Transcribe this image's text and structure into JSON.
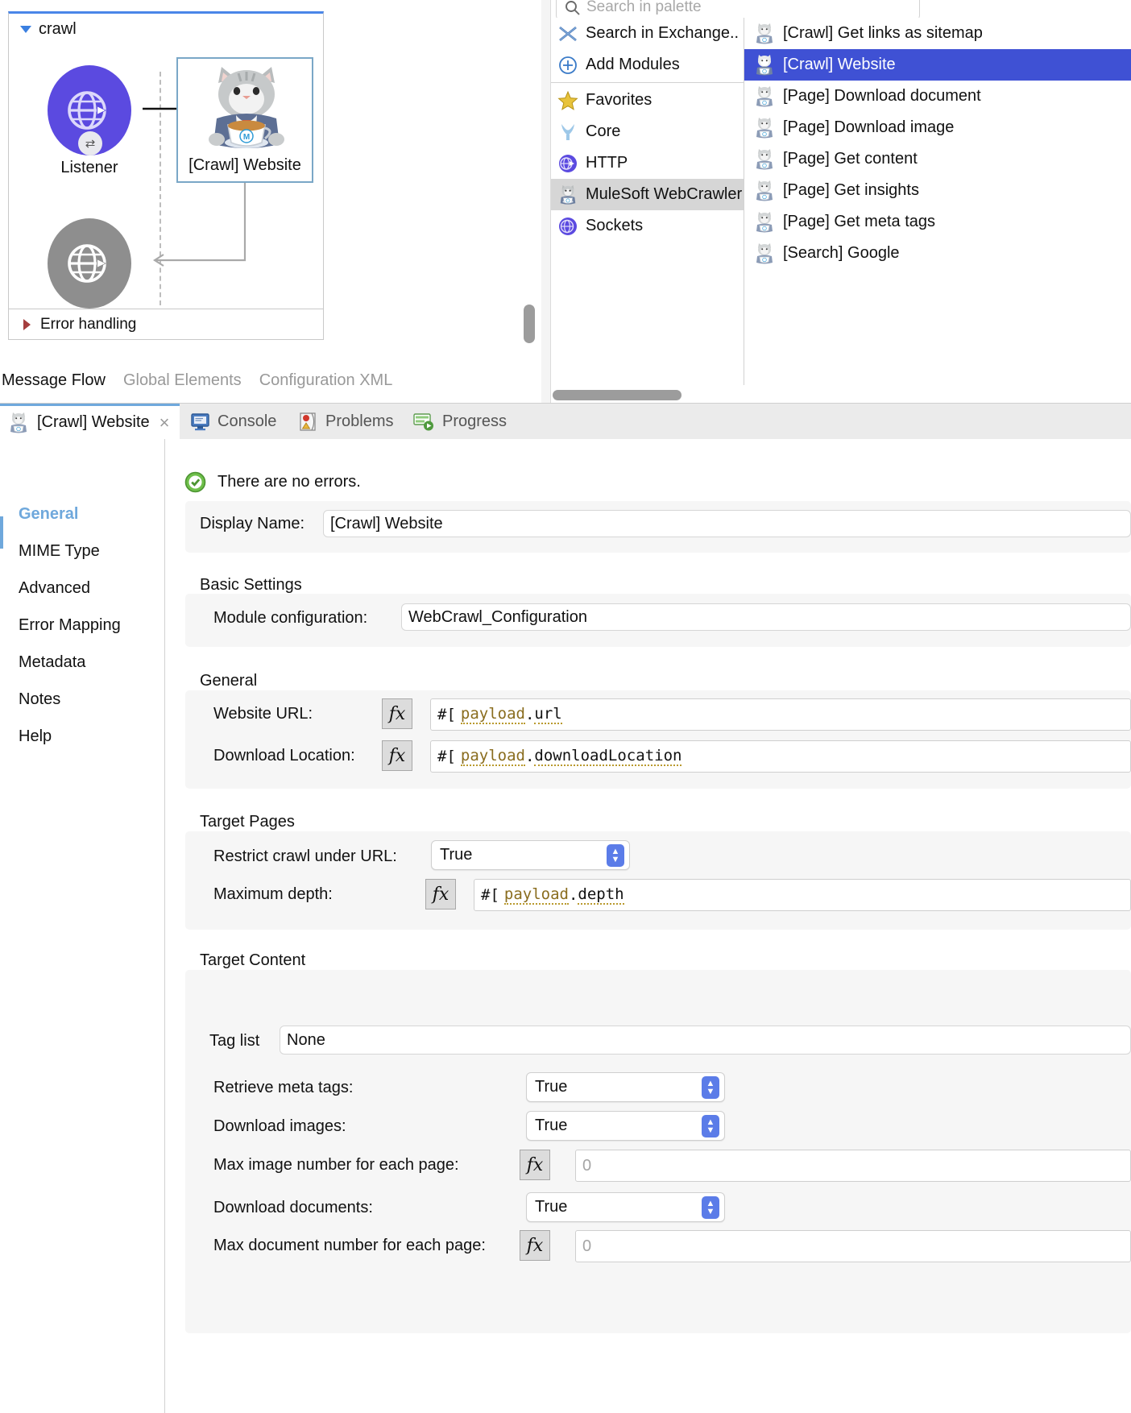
{
  "canvas": {
    "flow_name": "crawl",
    "nodes": [
      {
        "label": "Listener",
        "icon": "globe-arrow-icon"
      },
      {
        "label": "[Crawl] Website",
        "icon": "mulesoft-cat-icon"
      },
      {
        "label": "",
        "icon": "globe-arrow-icon"
      }
    ],
    "error_handling_label": "Error handling",
    "editor_tabs": [
      {
        "label": "Message Flow",
        "active": true
      },
      {
        "label": "Global Elements",
        "active": false
      },
      {
        "label": "Configuration XML",
        "active": false
      }
    ]
  },
  "palette": {
    "search_placeholder": "Search in palette",
    "categories": [
      {
        "label": "Search in Exchange..",
        "icon": "exchange-icon",
        "selected": false
      },
      {
        "label": "Add Modules",
        "icon": "plus-circle-icon",
        "selected": false
      },
      {
        "label": "Favorites",
        "icon": "star-icon",
        "selected": false
      },
      {
        "label": "Core",
        "icon": "mule-icon",
        "selected": false
      },
      {
        "label": "HTTP",
        "icon": "globe-icon",
        "selected": false
      },
      {
        "label": "MuleSoft WebCrawler",
        "icon": "cat-icon",
        "selected": true
      },
      {
        "label": "Sockets",
        "icon": "globe-icon",
        "selected": false
      }
    ],
    "operations": [
      {
        "label": "[Crawl] Get links as sitemap",
        "highlighted": false
      },
      {
        "label": "[Crawl] Website",
        "highlighted": true
      },
      {
        "label": "[Page] Download document",
        "highlighted": false
      },
      {
        "label": "[Page] Download image",
        "highlighted": false
      },
      {
        "label": "[Page] Get content",
        "highlighted": false
      },
      {
        "label": "[Page] Get insights",
        "highlighted": false
      },
      {
        "label": "[Page] Get meta tags",
        "highlighted": false
      },
      {
        "label": "[Search] Google",
        "highlighted": false
      }
    ],
    "highlight_color": "#3f51d4"
  },
  "view_tabs": {
    "active": {
      "label": "[Crawl] Website",
      "icon": "cat-icon",
      "close": "×"
    },
    "others": [
      {
        "label": "Console",
        "icon": "console-icon"
      },
      {
        "label": "Problems",
        "icon": "problems-icon"
      },
      {
        "label": "Progress",
        "icon": "progress-icon"
      }
    ]
  },
  "properties": {
    "sidebar": [
      {
        "label": "General",
        "active": true
      },
      {
        "label": "MIME Type",
        "active": false
      },
      {
        "label": "Advanced",
        "active": false
      },
      {
        "label": "Error Mapping",
        "active": false
      },
      {
        "label": "Metadata",
        "active": false
      },
      {
        "label": "Notes",
        "active": false
      },
      {
        "label": "Help",
        "active": false
      }
    ],
    "status": {
      "text": "There are no errors.",
      "icon": "check-circle-icon"
    },
    "display_name": {
      "label": "Display Name:",
      "value": "[Crawl] Website"
    },
    "groups": {
      "basic_settings": {
        "title": "Basic Settings",
        "module_configuration": {
          "label": "Module configuration:",
          "value": "WebCrawl_Configuration"
        }
      },
      "general": {
        "title": "General",
        "website_url": {
          "label": "Website URL:",
          "prefix": "#[",
          "ident": "payload",
          "dot": ".",
          "tail": "url",
          "fx": "fx"
        },
        "download_location": {
          "label": "Download Location:",
          "prefix": "#[",
          "ident": "payload",
          "dot": ".",
          "tail": "downloadLocation",
          "fx": "fx"
        }
      },
      "target_pages": {
        "title": "Target Pages",
        "restrict_crawl": {
          "label": "Restrict crawl under URL:",
          "value": "True"
        },
        "maximum_depth": {
          "label": "Maximum depth:",
          "prefix": "#[",
          "ident": "payload",
          "dot": ".",
          "tail": "depth",
          "fx": "fx"
        }
      },
      "target_content": {
        "title": "Target Content",
        "tag_list": {
          "label": "Tag list",
          "value": "None"
        },
        "retrieve_meta_tags": {
          "label": "Retrieve meta tags:",
          "value": "True"
        },
        "download_images": {
          "label": "Download images:",
          "value": "True"
        },
        "max_image_number": {
          "label": "Max image number for each page:",
          "value": "0",
          "fx": "fx"
        },
        "download_documents": {
          "label": "Download documents:",
          "value": "True"
        },
        "max_document_number": {
          "label": "Max document number for each page:",
          "value": "0",
          "fx": "fx"
        }
      }
    }
  }
}
